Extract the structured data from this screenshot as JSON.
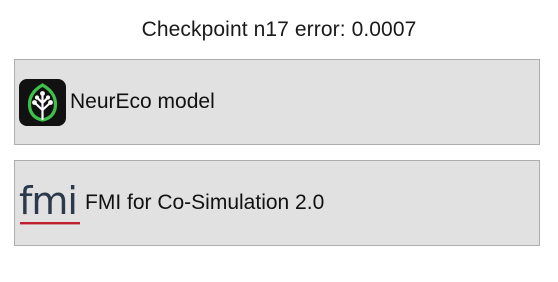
{
  "header": {
    "title": "Checkpoint n17 error: 0.0007"
  },
  "buttons": [
    {
      "label": "NeurEco model",
      "icon": "neureco-leaf-icon"
    },
    {
      "label": "FMI for Co-Simulation 2.0",
      "icon": "fmi-logo-icon",
      "icon_text": "fmi"
    }
  ],
  "colors": {
    "button_bg": "#e1e1e1",
    "button_border": "#adadad",
    "neureco_logo_bg": "#111111",
    "neureco_leaf": "#3ec04a",
    "fmi_text": "#2b3a4a",
    "fmi_underline": "#c0202e"
  }
}
